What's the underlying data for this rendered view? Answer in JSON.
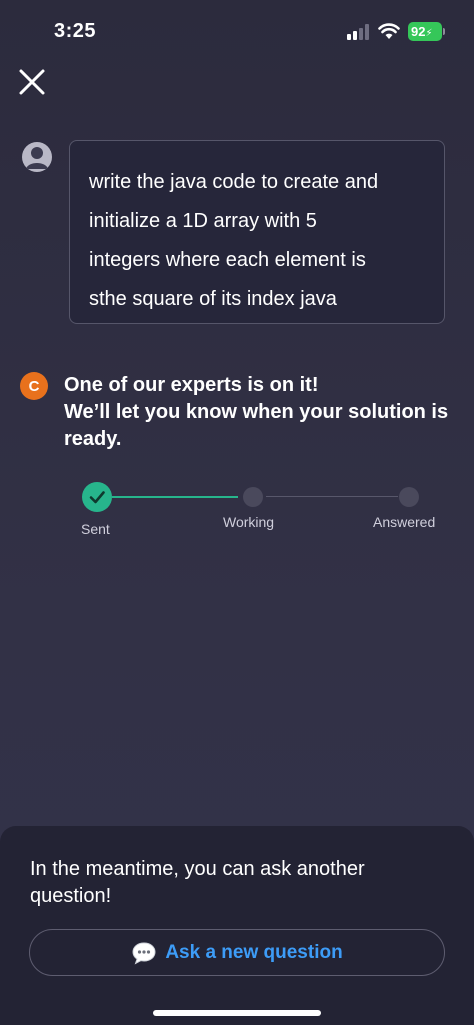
{
  "status_bar": {
    "time": "3:25",
    "battery_level": "92",
    "icons": [
      "signal-icon",
      "wifi-icon",
      "battery-icon"
    ]
  },
  "header": {
    "close_icon": "close-icon"
  },
  "question": {
    "avatar_icon": "user-avatar-icon",
    "lines": [
      "write the java code to create and",
      "initialize a 1D array with 5",
      "integers where each element is",
      "sthe square of its index java"
    ]
  },
  "expert": {
    "badge_letter": "C",
    "title": "One of our experts is on it!",
    "subtitle": "We’ll let you know when your solution is ready."
  },
  "progress": {
    "steps": [
      {
        "label": "Sent",
        "state": "done"
      },
      {
        "label": "Working",
        "state": "pending"
      },
      {
        "label": "Answered",
        "state": "pending"
      }
    ]
  },
  "bottom_sheet": {
    "text": "In the meantime, you can ask another question!",
    "button_icon": "speech-bubble-icon",
    "button_label": "Ask a new question"
  },
  "colors": {
    "background": "#302f42",
    "accent_green": "#27b58c",
    "link_blue": "#3d9cf7",
    "expert_orange": "#e8711c",
    "battery_green": "#35c759"
  }
}
